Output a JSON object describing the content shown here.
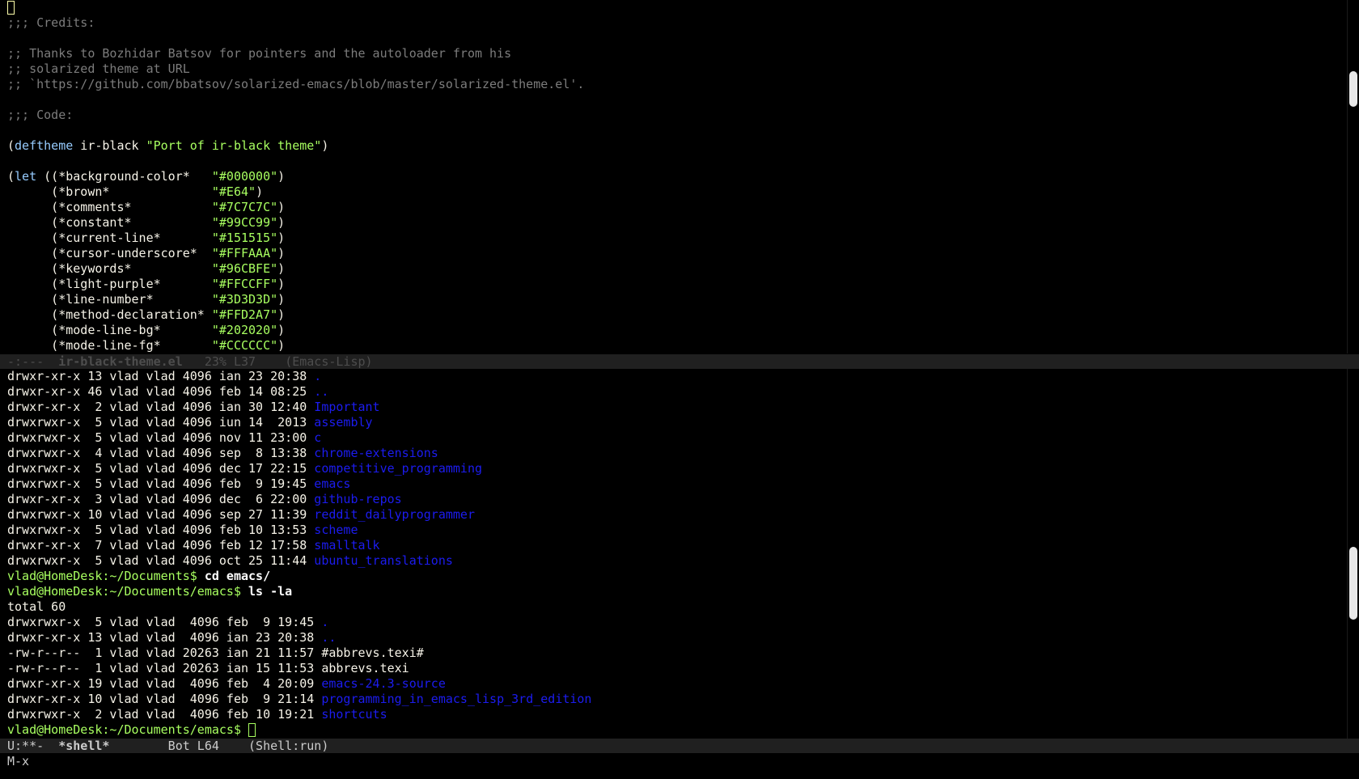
{
  "editor": {
    "first_line_cursor": "",
    "code_lines": [
      {
        "parts": [
          {
            "t": ";;; Credits:",
            "c": "comment"
          }
        ]
      },
      {
        "parts": []
      },
      {
        "parts": [
          {
            "t": ";; Thanks to Bozhidar Batsov for pointers and the autoloader from his",
            "c": "comment"
          }
        ]
      },
      {
        "parts": [
          {
            "t": ";; solarized theme at URL",
            "c": "comment"
          }
        ]
      },
      {
        "parts": [
          {
            "t": ";; `https://github.com/bbatsov/solarized-emacs/blob/master/solarized-theme.el'.",
            "c": "comment"
          }
        ]
      },
      {
        "parts": []
      },
      {
        "parts": [
          {
            "t": ";;; Code:",
            "c": "comment"
          }
        ]
      },
      {
        "parts": []
      },
      {
        "parts": [
          {
            "t": "(",
            "c": "normal"
          },
          {
            "t": "deftheme",
            "c": "kw"
          },
          {
            "t": " ir-black ",
            "c": "normal"
          },
          {
            "t": "\"Port of ir-black theme\"",
            "c": "string"
          },
          {
            "t": ")",
            "c": "normal"
          }
        ]
      },
      {
        "parts": []
      },
      {
        "parts": [
          {
            "t": "(",
            "c": "normal"
          },
          {
            "t": "let",
            "c": "kw"
          },
          {
            "t": " ((*background-color*   ",
            "c": "normal"
          },
          {
            "t": "\"#000000\"",
            "c": "string"
          },
          {
            "t": ")",
            "c": "normal"
          }
        ]
      },
      {
        "parts": [
          {
            "t": "      (*brown*              ",
            "c": "normal"
          },
          {
            "t": "\"#E64\"",
            "c": "string"
          },
          {
            "t": ")",
            "c": "normal"
          }
        ]
      },
      {
        "parts": [
          {
            "t": "      (*comments*           ",
            "c": "normal"
          },
          {
            "t": "\"#7C7C7C\"",
            "c": "string"
          },
          {
            "t": ")",
            "c": "normal"
          }
        ]
      },
      {
        "parts": [
          {
            "t": "      (*constant*           ",
            "c": "normal"
          },
          {
            "t": "\"#99CC99\"",
            "c": "string"
          },
          {
            "t": ")",
            "c": "normal"
          }
        ]
      },
      {
        "parts": [
          {
            "t": "      (*current-line*       ",
            "c": "normal"
          },
          {
            "t": "\"#151515\"",
            "c": "string"
          },
          {
            "t": ")",
            "c": "normal"
          }
        ]
      },
      {
        "parts": [
          {
            "t": "      (*cursor-underscore*  ",
            "c": "normal"
          },
          {
            "t": "\"#FFFAAA\"",
            "c": "string"
          },
          {
            "t": ")",
            "c": "normal"
          }
        ]
      },
      {
        "parts": [
          {
            "t": "      (*keywords*           ",
            "c": "normal"
          },
          {
            "t": "\"#96CBFE\"",
            "c": "string"
          },
          {
            "t": ")",
            "c": "normal"
          }
        ]
      },
      {
        "parts": [
          {
            "t": "      (*light-purple*       ",
            "c": "normal"
          },
          {
            "t": "\"#FFCCFF\"",
            "c": "string"
          },
          {
            "t": ")",
            "c": "normal"
          }
        ]
      },
      {
        "parts": [
          {
            "t": "      (*line-number*        ",
            "c": "normal"
          },
          {
            "t": "\"#3D3D3D\"",
            "c": "string"
          },
          {
            "t": ")",
            "c": "normal"
          }
        ]
      },
      {
        "parts": [
          {
            "t": "      (*method-declaration* ",
            "c": "normal"
          },
          {
            "t": "\"#FFD2A7\"",
            "c": "string"
          },
          {
            "t": ")",
            "c": "normal"
          }
        ]
      },
      {
        "parts": [
          {
            "t": "      (*mode-line-bg*       ",
            "c": "normal"
          },
          {
            "t": "\"#202020\"",
            "c": "string"
          },
          {
            "t": ")",
            "c": "normal"
          }
        ]
      },
      {
        "parts": [
          {
            "t": "      (*mode-line-fg*       ",
            "c": "normal"
          },
          {
            "t": "\"#CCCCCC\"",
            "c": "string"
          },
          {
            "t": ")",
            "c": "normal"
          }
        ]
      }
    ]
  },
  "top_modeline": {
    "status": "-:---  ",
    "buffer": "ir-black-theme.el",
    "position": "   23% L37    ",
    "mode": "(Emacs-Lisp)"
  },
  "shell": {
    "lines": [
      {
        "parts": [
          {
            "t": "drwxr-xr-x 13 vlad vlad 4096 ian 23 20:38 ",
            "c": "normal"
          },
          {
            "t": ".",
            "c": "dir"
          }
        ]
      },
      {
        "parts": [
          {
            "t": "drwxr-xr-x 46 vlad vlad 4096 feb 14 08:25 ",
            "c": "normal"
          },
          {
            "t": "..",
            "c": "dir"
          }
        ]
      },
      {
        "parts": [
          {
            "t": "drwxr-xr-x  2 vlad vlad 4096 ian 30 12:40 ",
            "c": "normal"
          },
          {
            "t": "Important",
            "c": "dir"
          }
        ]
      },
      {
        "parts": [
          {
            "t": "drwxrwxr-x  5 vlad vlad 4096 iun 14  2013 ",
            "c": "normal"
          },
          {
            "t": "assembly",
            "c": "dir"
          }
        ]
      },
      {
        "parts": [
          {
            "t": "drwxrwxr-x  5 vlad vlad 4096 nov 11 23:00 ",
            "c": "normal"
          },
          {
            "t": "c",
            "c": "dir"
          }
        ]
      },
      {
        "parts": [
          {
            "t": "drwxrwxr-x  4 vlad vlad 4096 sep  8 13:38 ",
            "c": "normal"
          },
          {
            "t": "chrome-extensions",
            "c": "dir"
          }
        ]
      },
      {
        "parts": [
          {
            "t": "drwxrwxr-x  5 vlad vlad 4096 dec 17 22:15 ",
            "c": "normal"
          },
          {
            "t": "competitive_programming",
            "c": "dir"
          }
        ]
      },
      {
        "parts": [
          {
            "t": "drwxrwxr-x  5 vlad vlad 4096 feb  9 19:45 ",
            "c": "normal"
          },
          {
            "t": "emacs",
            "c": "dir"
          }
        ]
      },
      {
        "parts": [
          {
            "t": "drwxr-xr-x  3 vlad vlad 4096 dec  6 22:00 ",
            "c": "normal"
          },
          {
            "t": "github-repos",
            "c": "dir"
          }
        ]
      },
      {
        "parts": [
          {
            "t": "drwxrwxr-x 10 vlad vlad 4096 sep 27 11:39 ",
            "c": "normal"
          },
          {
            "t": "reddit_dailyprogrammer",
            "c": "dir"
          }
        ]
      },
      {
        "parts": [
          {
            "t": "drwxrwxr-x  5 vlad vlad 4096 feb 10 13:53 ",
            "c": "normal"
          },
          {
            "t": "scheme",
            "c": "dir"
          }
        ]
      },
      {
        "parts": [
          {
            "t": "drwxr-xr-x  7 vlad vlad 4096 feb 12 17:58 ",
            "c": "normal"
          },
          {
            "t": "smalltalk",
            "c": "dir"
          }
        ]
      },
      {
        "parts": [
          {
            "t": "drwxrwxr-x  5 vlad vlad 4096 oct 25 11:44 ",
            "c": "normal"
          },
          {
            "t": "ubuntu_translations",
            "c": "dir"
          }
        ]
      },
      {
        "parts": [
          {
            "t": "vlad@HomeDesk:~/Documents$ ",
            "c": "prompt"
          },
          {
            "t": "cd emacs/",
            "c": "cmd"
          }
        ]
      },
      {
        "parts": [
          {
            "t": "vlad@HomeDesk:~/Documents/emacs$ ",
            "c": "prompt"
          },
          {
            "t": "ls -la",
            "c": "cmd"
          }
        ]
      },
      {
        "parts": [
          {
            "t": "total 60",
            "c": "normal"
          }
        ]
      },
      {
        "parts": [
          {
            "t": "drwxrwxr-x  5 vlad vlad  4096 feb  9 19:45 ",
            "c": "normal"
          },
          {
            "t": ".",
            "c": "dir"
          }
        ]
      },
      {
        "parts": [
          {
            "t": "drwxr-xr-x 13 vlad vlad  4096 ian 23 20:38 ",
            "c": "normal"
          },
          {
            "t": "..",
            "c": "dir"
          }
        ]
      },
      {
        "parts": [
          {
            "t": "-rw-r--r--  1 vlad vlad 20263 ian 21 11:57 #abbrevs.texi#",
            "c": "normal"
          }
        ]
      },
      {
        "parts": [
          {
            "t": "-rw-r--r--  1 vlad vlad 20263 ian 15 11:53 abbrevs.texi",
            "c": "normal"
          }
        ]
      },
      {
        "parts": [
          {
            "t": "drwxr-xr-x 19 vlad vlad  4096 feb  4 20:09 ",
            "c": "normal"
          },
          {
            "t": "emacs-24.3-source",
            "c": "dir"
          }
        ]
      },
      {
        "parts": [
          {
            "t": "drwxr-xr-x 10 vlad vlad  4096 feb  9 21:14 ",
            "c": "normal"
          },
          {
            "t": "programming_in_emacs_lisp_3rd_edition",
            "c": "dir"
          }
        ]
      },
      {
        "parts": [
          {
            "t": "drwxrwxr-x  2 vlad vlad  4096 feb 10 19:21 ",
            "c": "normal"
          },
          {
            "t": "shortcuts",
            "c": "dir"
          }
        ]
      }
    ],
    "final_prompt": "vlad@HomeDesk:~/Documents/emacs$ "
  },
  "bottom_modeline": {
    "status": "U:**-  ",
    "buffer": "*shell*",
    "position": "        Bot L64    ",
    "mode": "(Shell:run)"
  },
  "minibuffer": {
    "text": "M-x"
  }
}
